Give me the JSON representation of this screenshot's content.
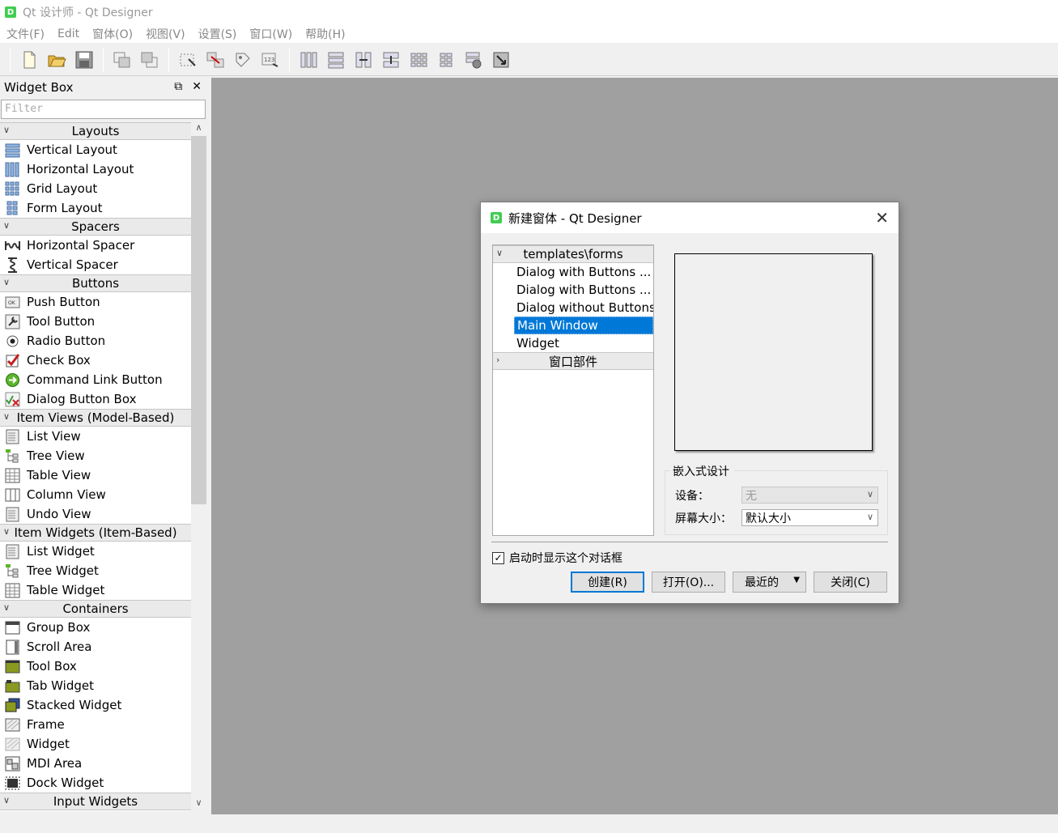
{
  "app": {
    "title": "Qt 设计师 - Qt Designer",
    "icon_letter": "D"
  },
  "menu": [
    "文件(F)",
    "Edit",
    "窗体(O)",
    "视图(V)",
    "设置(S)",
    "窗口(W)",
    "帮助(H)"
  ],
  "widget_box": {
    "title": "Widget Box",
    "filter_placeholder": "Filter",
    "categories": {
      "layouts": "Layouts",
      "spacers": "Spacers",
      "buttons": "Buttons",
      "item_views": "Item Views (Model-Based)",
      "item_widgets": "Item Widgets (Item-Based)",
      "containers": "Containers",
      "input_widgets": "Input Widgets"
    },
    "items": {
      "vertical_layout": "Vertical Layout",
      "horizontal_layout": "Horizontal Layout",
      "grid_layout": "Grid Layout",
      "form_layout": "Form Layout",
      "horizontal_spacer": "Horizontal Spacer",
      "vertical_spacer": "Vertical Spacer",
      "push_button": "Push Button",
      "tool_button": "Tool Button",
      "radio_button": "Radio Button",
      "check_box": "Check Box",
      "command_link_button": "Command Link Button",
      "dialog_button_box": "Dialog Button Box",
      "list_view": "List View",
      "tree_view": "Tree View",
      "table_view": "Table View",
      "column_view": "Column View",
      "undo_view": "Undo View",
      "list_widget": "List Widget",
      "tree_widget": "Tree Widget",
      "table_widget": "Table Widget",
      "group_box": "Group Box",
      "scroll_area": "Scroll Area",
      "tool_box": "Tool Box",
      "tab_widget": "Tab Widget",
      "stacked_widget": "Stacked Widget",
      "frame": "Frame",
      "widget": "Widget",
      "mdi_area": "MDI Area",
      "dock_widget": "Dock Widget"
    }
  },
  "dialog": {
    "title": "新建窗体 - Qt Designer",
    "templates_header": "templates\\forms",
    "templates": [
      "Dialog with Buttons ...",
      "Dialog with Buttons ...",
      "Dialog without Buttons",
      "Main Window",
      "Widget"
    ],
    "selected_template": "Main Window",
    "widgets_header": "窗口部件",
    "embedded_legend": "嵌入式设计",
    "device_label": "设备：",
    "device_value": "无",
    "screen_size_label": "屏幕大小：",
    "screen_size_value": "默认大小",
    "show_on_startup": "启动时显示这个对话框",
    "show_on_startup_checked": true,
    "buttons": {
      "create": "创建(R)",
      "open": "打开(O)...",
      "recent": "最近的",
      "close": "关闭(C)"
    }
  },
  "colors": {
    "selection": "#0078d7",
    "mdi_background": "#a0a0a0",
    "qt_green": "#41cd52"
  }
}
